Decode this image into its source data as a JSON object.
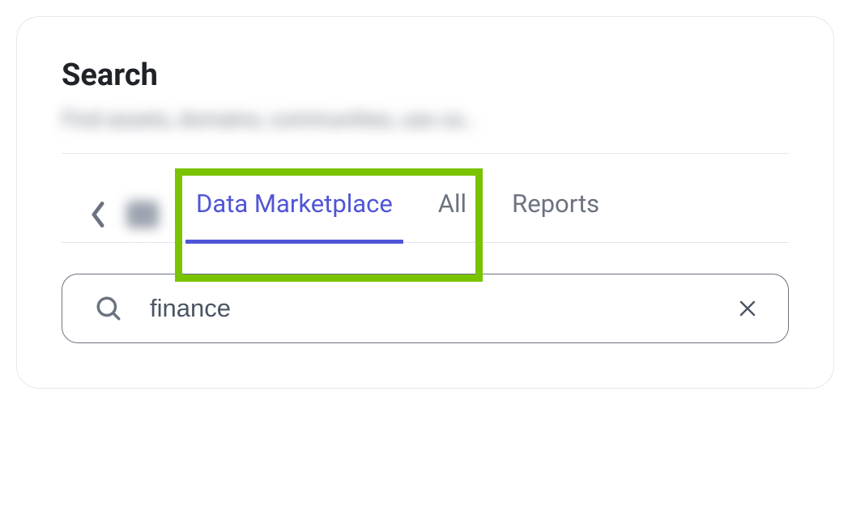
{
  "header": {
    "title": "Search",
    "subtitle": "Find assets, domains, communities, use ca…"
  },
  "tabs": {
    "active_index": 0,
    "items": [
      {
        "label": "Data Marketplace"
      },
      {
        "label": "All"
      },
      {
        "label": "Reports"
      }
    ]
  },
  "search": {
    "value": "finance",
    "placeholder": ""
  },
  "highlight": {
    "color": "#7ac300"
  }
}
